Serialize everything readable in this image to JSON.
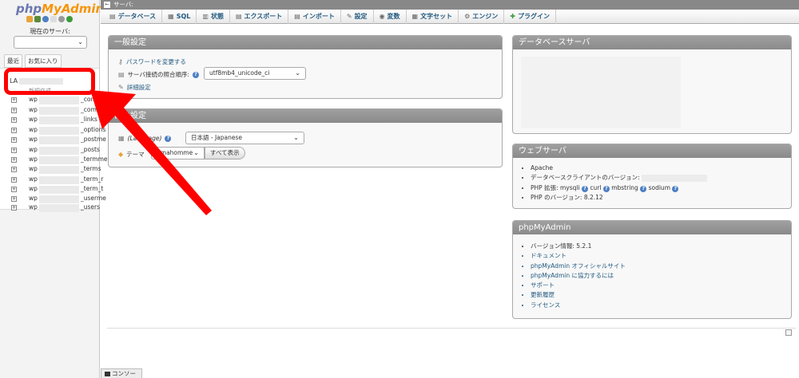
{
  "nav": {
    "logo_php": "php",
    "logo_myadmin": "MyAdmin",
    "current_server_label": "現在のサーバ:",
    "tabs": [
      "最近",
      "お気に入り"
    ],
    "db_name": "LA",
    "new_label": "新規作成",
    "tables": [
      {
        "prefix": "wp",
        "suffix": "_comm"
      },
      {
        "prefix": "wp",
        "suffix": "_comm"
      },
      {
        "prefix": "wp",
        "suffix": "_links"
      },
      {
        "prefix": "wp",
        "suffix": "_options"
      },
      {
        "prefix": "wp",
        "suffix": "_postme"
      },
      {
        "prefix": "wp",
        "suffix": "_posts"
      },
      {
        "prefix": "wp",
        "suffix": "_termme"
      },
      {
        "prefix": "wp",
        "suffix": "_terms"
      },
      {
        "prefix": "wp",
        "suffix": "_term_r"
      },
      {
        "prefix": "wp",
        "suffix": "_term_t"
      },
      {
        "prefix": "wp",
        "suffix": "_userme"
      },
      {
        "prefix": "wp",
        "suffix": "_users"
      }
    ]
  },
  "serverbar": {
    "label": "サーバ:"
  },
  "menu": [
    {
      "icon": "database-icon",
      "glyph": "▤",
      "label": "データベース"
    },
    {
      "icon": "sql-icon",
      "glyph": "▦",
      "label": "SQL"
    },
    {
      "icon": "status-icon",
      "glyph": "▥",
      "label": "状態"
    },
    {
      "icon": "export-icon",
      "glyph": "▤",
      "label": "エクスポート"
    },
    {
      "icon": "import-icon",
      "glyph": "▤",
      "label": "インポート"
    },
    {
      "icon": "settings-icon",
      "glyph": "✎",
      "label": "設定"
    },
    {
      "icon": "variables-icon",
      "glyph": "◉",
      "label": "変数"
    },
    {
      "icon": "charset-icon",
      "glyph": "▦",
      "label": "文字セット"
    },
    {
      "icon": "engine-icon",
      "glyph": "⚙",
      "label": "エンジン"
    },
    {
      "icon": "plugin-icon",
      "glyph": "✚",
      "label": "プラグイン"
    }
  ],
  "general": {
    "title": "一般設定",
    "change_password": "パスワードを変更する",
    "collation_label": "サーバ接続の照合順序:",
    "collation_value": "utf8mb4_unicode_ci",
    "more_settings": "詳細設定"
  },
  "appearance": {
    "title": "観の設定",
    "language_label": "(Language)",
    "language_value": "日本語 - Japanese",
    "theme_label": "テーマ",
    "theme_value": "pmahomme",
    "show_all": "すべて表示"
  },
  "db_server": {
    "title": "データベースサーバ"
  },
  "web_server": {
    "title": "ウェブサーバ",
    "items": {
      "apache": "Apache",
      "client_version": "データベースクライアントのバージョン:",
      "php_ext_label": "PHP 拡張:",
      "ext1": "mysqli",
      "ext2": "curl",
      "ext3": "mbstring",
      "ext4": "sodium",
      "php_version": "PHP のバージョン: 8.2.12"
    }
  },
  "pma": {
    "title": "phpMyAdmin",
    "items": [
      "バージョン情報: 5.2.1",
      "ドキュメント",
      "phpMyAdmin オフィシャルサイト",
      "phpMyAdmin に協力するには",
      "サポート",
      "更新履歴",
      "ライセンス"
    ]
  },
  "console": {
    "label": "コンソール"
  },
  "colors": {
    "annotation": "#ff0000",
    "link": "#235a81",
    "accent": "#f89406"
  }
}
